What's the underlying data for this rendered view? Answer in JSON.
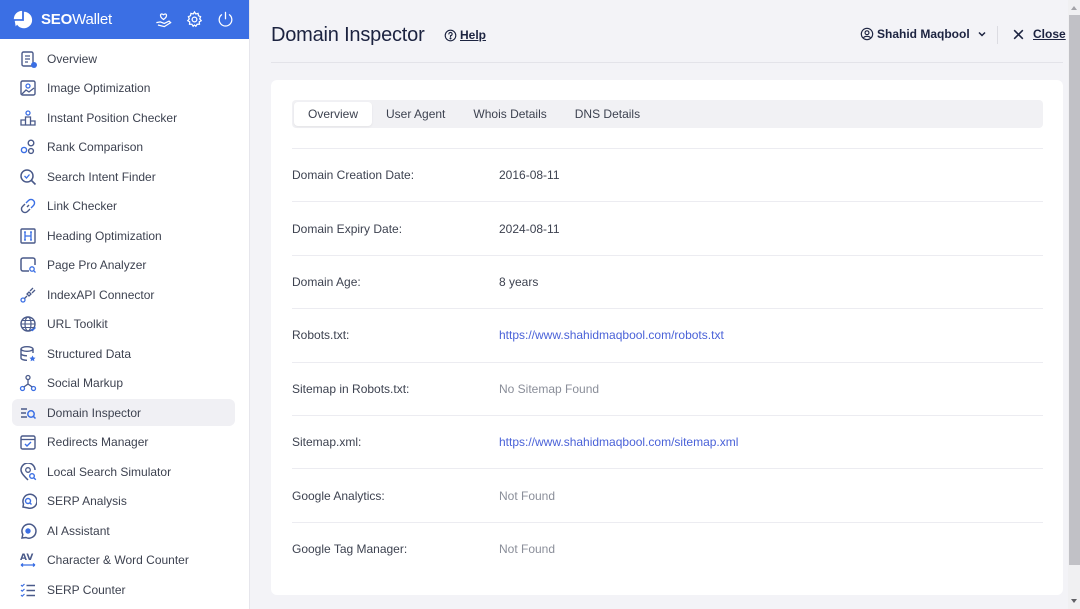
{
  "app": {
    "brand_bold": "SEO",
    "brand_rest": "Wallet",
    "accent_color": "#3b6fe4"
  },
  "sidebar": {
    "items": [
      {
        "label": "Overview",
        "icon": "overview-icon"
      },
      {
        "label": "Image Optimization",
        "icon": "image-icon"
      },
      {
        "label": "Instant Position Checker",
        "icon": "podium-icon"
      },
      {
        "label": "Rank Comparison",
        "icon": "rank-compare-icon"
      },
      {
        "label": "Search Intent Finder",
        "icon": "search-check-icon"
      },
      {
        "label": "Link Checker",
        "icon": "link-icon"
      },
      {
        "label": "Heading Optimization",
        "icon": "heading-icon"
      },
      {
        "label": "Page Pro Analyzer",
        "icon": "page-analyze-icon"
      },
      {
        "label": "IndexAPI Connector",
        "icon": "plug-icon"
      },
      {
        "label": "URL Toolkit",
        "icon": "globe-icon"
      },
      {
        "label": "Structured Data",
        "icon": "database-icon"
      },
      {
        "label": "Social Markup",
        "icon": "share-network-icon"
      },
      {
        "label": "Domain Inspector",
        "icon": "domain-inspect-icon",
        "active": true
      },
      {
        "label": "Redirects Manager",
        "icon": "calendar-check-icon"
      },
      {
        "label": "Local Search Simulator",
        "icon": "location-search-icon"
      },
      {
        "label": "SERP Analysis",
        "icon": "chat-search-icon"
      },
      {
        "label": "AI Assistant",
        "icon": "ai-chat-icon"
      },
      {
        "label": "Character & Word Counter",
        "icon": "text-width-icon"
      },
      {
        "label": "SERP Counter",
        "icon": "checklist-icon"
      }
    ]
  },
  "header": {
    "title": "Domain Inspector",
    "help_label": "Help",
    "user_name": "Shahid Maqbool",
    "close_label": "Close"
  },
  "tabs": [
    {
      "label": "Overview",
      "active": true
    },
    {
      "label": "User Agent"
    },
    {
      "label": "Whois Details"
    },
    {
      "label": "DNS Details"
    }
  ],
  "rows": [
    {
      "label": "Domain Creation Date:",
      "value": "2016-08-11",
      "kind": "text"
    },
    {
      "label": "Domain Expiry Date:",
      "value": "2024-08-11",
      "kind": "text"
    },
    {
      "label": "Domain Age:",
      "value": "8 years",
      "kind": "text"
    },
    {
      "label": "Robots.txt:",
      "value": "https://www.shahidmaqbool.com/robots.txt",
      "kind": "link"
    },
    {
      "label": "Sitemap in Robots.txt:",
      "value": "No Sitemap Found",
      "kind": "muted"
    },
    {
      "label": "Sitemap.xml:",
      "value": "https://www.shahidmaqbool.com/sitemap.xml",
      "kind": "link"
    },
    {
      "label": "Google Analytics:",
      "value": "Not Found",
      "kind": "muted"
    },
    {
      "label": "Google Tag Manager:",
      "value": "Not Found",
      "kind": "muted"
    }
  ]
}
